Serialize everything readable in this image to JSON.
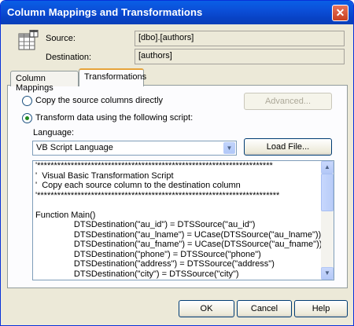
{
  "window": {
    "title": "Column Mappings and Transformations",
    "close_glyph": "✕"
  },
  "source": {
    "label": "Source:",
    "value": "[dbo].[authors]"
  },
  "destination": {
    "label": "Destination:",
    "value": "[authors]"
  },
  "tabs": [
    {
      "label": "Column Mappings",
      "active": false
    },
    {
      "label": "Transformations",
      "active": true
    }
  ],
  "options": {
    "copy_label": "Copy the source columns directly",
    "transform_label": "Transform data using the following script:",
    "selected": "transform"
  },
  "advanced_button": "Advanced...",
  "language": {
    "label": "Language:",
    "value": "VB Script Language",
    "arrow": "▼"
  },
  "load_file_button": "Load File...",
  "script": "'**********************************************************************\n'  Visual Basic Transformation Script\n'  Copy each source column to the destination column\n'************************************************************************\n\nFunction Main()\n\t\tDTSDestination(\"au_id\") = DTSSource(\"au_id\")\n\t\tDTSDestination(\"au_lname\") = UCase(DTSSource(\"au_lname\"))\n\t\tDTSDestination(\"au_fname\") = UCase(DTSSource(\"au_fname\"))\n\t\tDTSDestination(\"phone\") = DTSSource(\"phone\")\n\t\tDTSDestination(\"address\") = DTSSource(\"address\")\n\t\tDTSDestination(\"city\") = DTSSource(\"city\")",
  "scrollbar": {
    "up": "▲",
    "down": "▼"
  },
  "footer": {
    "ok": "OK",
    "cancel": "Cancel",
    "help": "Help"
  },
  "icons": {
    "table": "table-icon"
  }
}
